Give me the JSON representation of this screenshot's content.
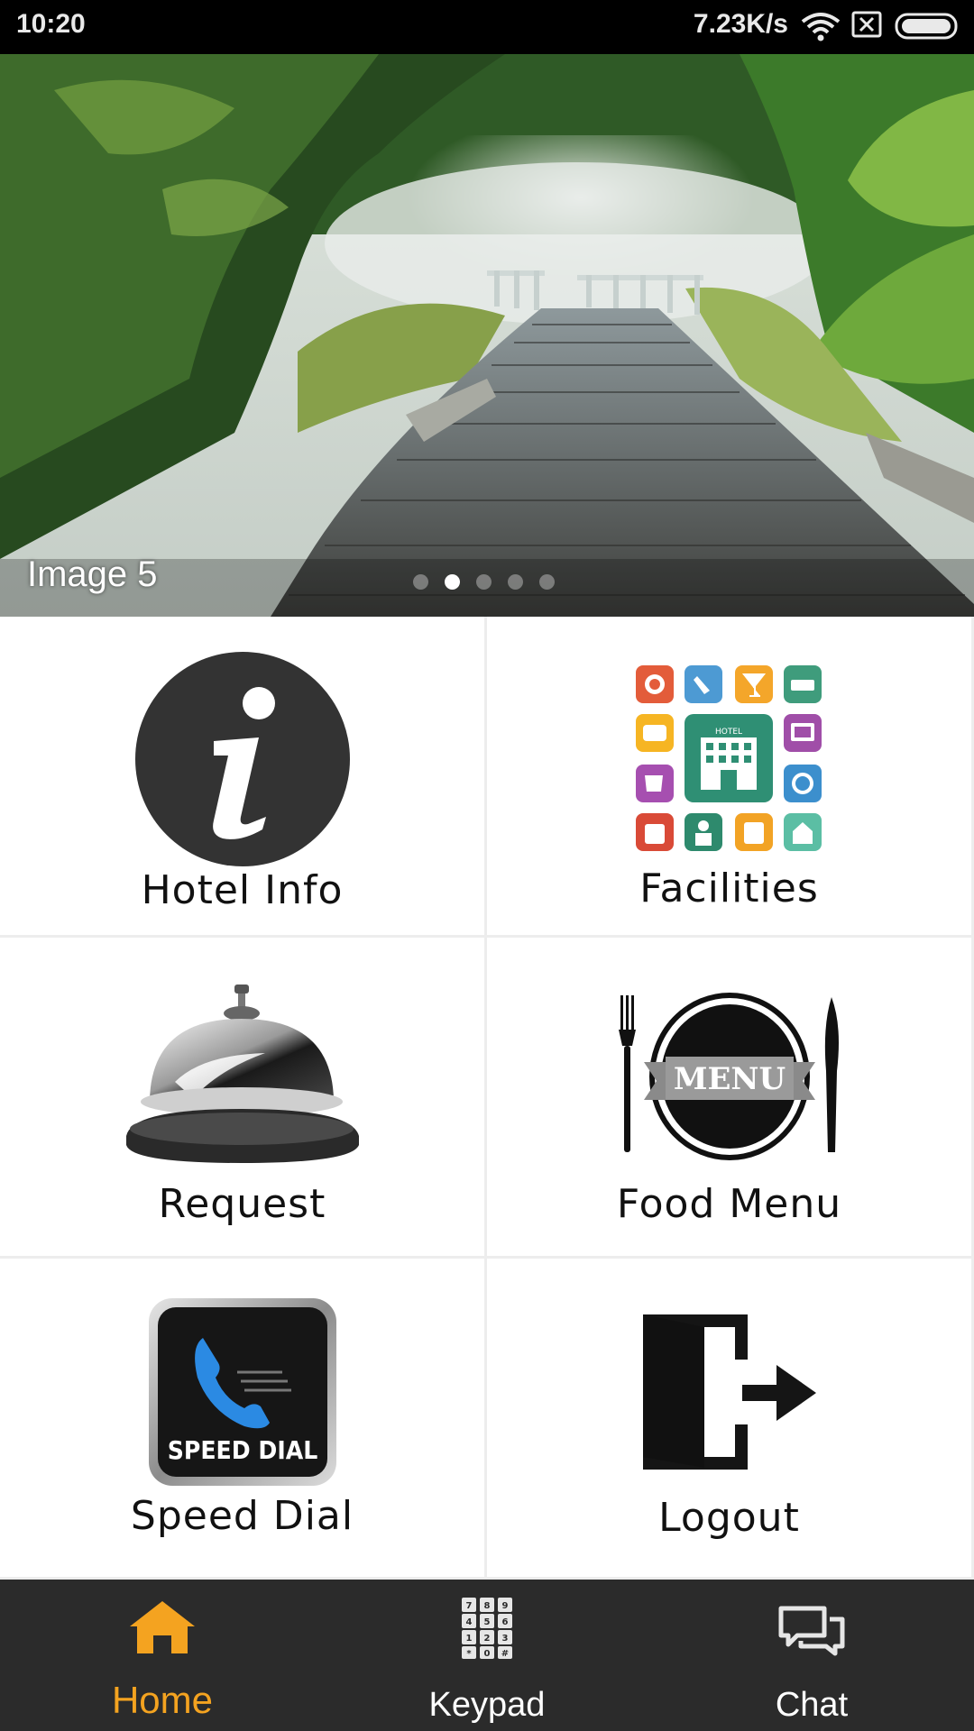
{
  "status_bar": {
    "time": "10:20",
    "net_speed": "7.23K/s",
    "icons": [
      "wifi-icon",
      "sim-missing-icon",
      "battery-icon"
    ]
  },
  "banner": {
    "caption": "Image 5",
    "slide_count": 5,
    "active_slide": 1
  },
  "grid": {
    "tiles": [
      {
        "label": "Hotel Info",
        "icon": "info-icon"
      },
      {
        "label": "Facilities",
        "icon": "hotel-facilities-icon"
      },
      {
        "label": "Request",
        "icon": "service-bell-icon"
      },
      {
        "label": "Food Menu",
        "icon": "food-menu-icon"
      },
      {
        "label": "Speed Dial",
        "icon": "speed-dial-icon",
        "icon_text": "SPEED DIAL"
      },
      {
        "label": "Logout",
        "icon": "logout-icon"
      }
    ],
    "food_menu_badge": "MENU",
    "facilities_sign": "HOTEL"
  },
  "bottom_nav": {
    "items": [
      {
        "label": "Home",
        "icon": "home-icon",
        "active": true
      },
      {
        "label": "Keypad",
        "icon": "keypad-icon",
        "active": false
      },
      {
        "label": "Chat",
        "icon": "chat-icon",
        "active": false
      }
    ],
    "keypad_digits": [
      "7",
      "8",
      "9",
      "4",
      "5",
      "6",
      "1",
      "2",
      "3",
      "*",
      "0",
      "#"
    ]
  },
  "colors": {
    "accent": "#f4a320",
    "nav_bg": "#2b2b2b",
    "status_bg": "#000000",
    "divider": "#ededed"
  }
}
